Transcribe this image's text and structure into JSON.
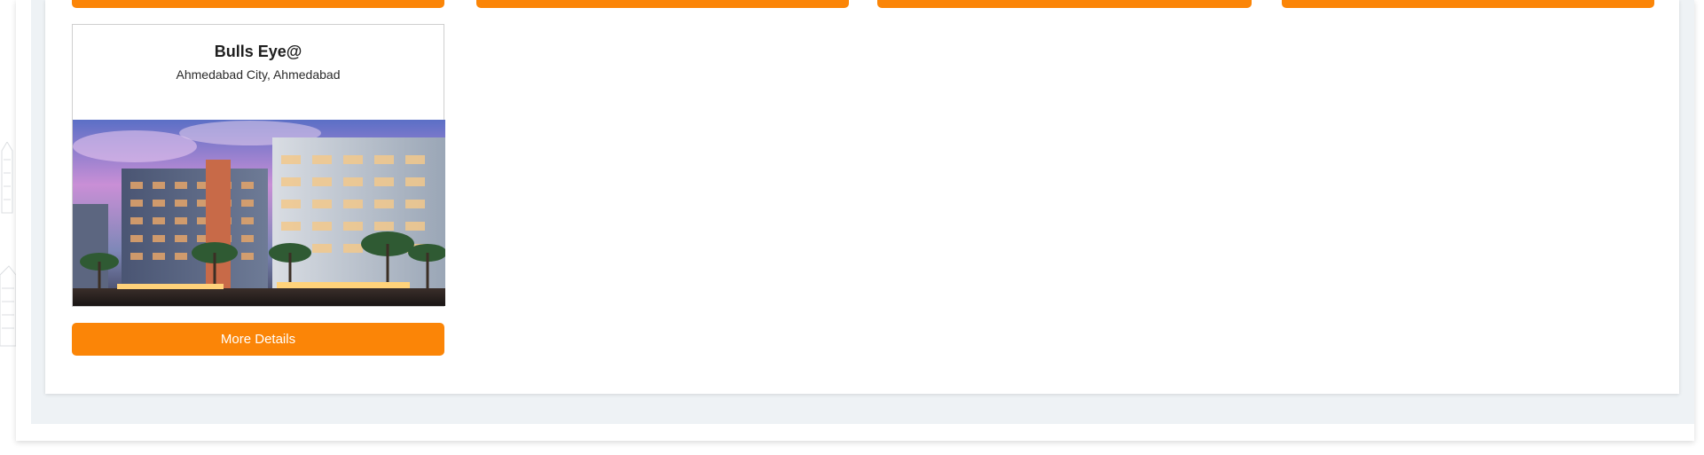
{
  "colors": {
    "accent": "#fb8507",
    "panel_bg": "#ffffff",
    "page_band": "#eef2f5"
  },
  "listings": [
    {
      "title": "Bulls Eye@",
      "location": "Ahmedabad City, Ahmedabad",
      "image": "building-photo",
      "button_label": "More Details"
    }
  ]
}
